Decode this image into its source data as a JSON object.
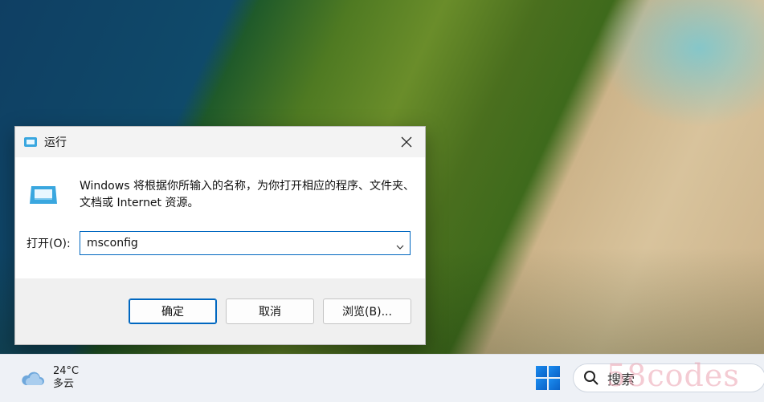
{
  "dialog": {
    "title": "运行",
    "description": "Windows 将根据你所输入的名称，为你打开相应的程序、文件夹、文档或 Internet 资源。",
    "open_label": "打开(O):",
    "open_value": "msconfig",
    "buttons": {
      "ok": "确定",
      "cancel": "取消",
      "browse": "浏览(B)..."
    }
  },
  "taskbar": {
    "weather": {
      "temperature": "24°C",
      "condition": "多云"
    },
    "search_label": "搜索"
  },
  "watermark": "58codes",
  "colors": {
    "accent": "#0067c0",
    "dialog_bg": "#f0f0f0",
    "taskbar_bg": "#eef1f6"
  },
  "icons": [
    "run-icon",
    "close-icon",
    "run-large-icon",
    "chevron-down-icon",
    "cloud-icon",
    "windows-start-icon",
    "search-icon"
  ]
}
